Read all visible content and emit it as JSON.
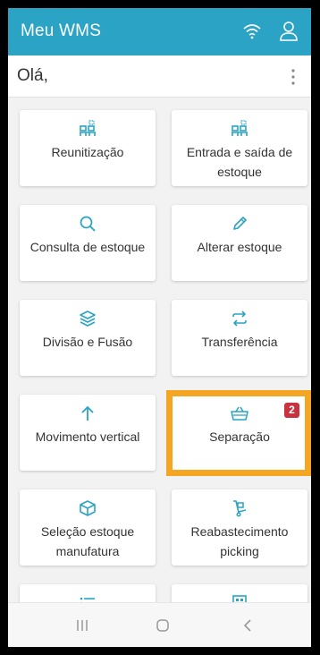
{
  "app": {
    "title": "Meu WMS"
  },
  "header": {
    "greeting": "Olá,"
  },
  "icons": {
    "wifi": "wifi-icon",
    "user": "user-icon",
    "more": "more-vert-icon"
  },
  "colors": {
    "primary": "#2ba3c4",
    "highlight": "#f4a623",
    "badge": "#c8323e"
  },
  "tiles": [
    {
      "label": "Reunitização",
      "icon": "pallets-icon"
    },
    {
      "label": "Entrada e saída de estoque",
      "icon": "pallets-icon"
    },
    {
      "label": "Consulta de estoque",
      "icon": "search-icon"
    },
    {
      "label": "Alterar estoque",
      "icon": "pencil-icon"
    },
    {
      "label": "Divisão e Fusão",
      "icon": "layers-icon"
    },
    {
      "label": "Transferência",
      "icon": "swap-icon"
    },
    {
      "label": "Movimento vertical",
      "icon": "arrow-up-icon"
    },
    {
      "label": "Separação",
      "icon": "basket-icon",
      "badge": "2"
    },
    {
      "label": "Seleção estoque manufatura",
      "icon": "box-icon"
    },
    {
      "label": "Reabastecimento picking",
      "icon": "hand-truck-icon"
    },
    {
      "label": "",
      "icon": "list-icon"
    },
    {
      "label": "",
      "icon": "building-icon"
    }
  ],
  "navbar": {
    "recent": "recent-apps-icon",
    "home": "home-icon",
    "back": "back-icon"
  }
}
